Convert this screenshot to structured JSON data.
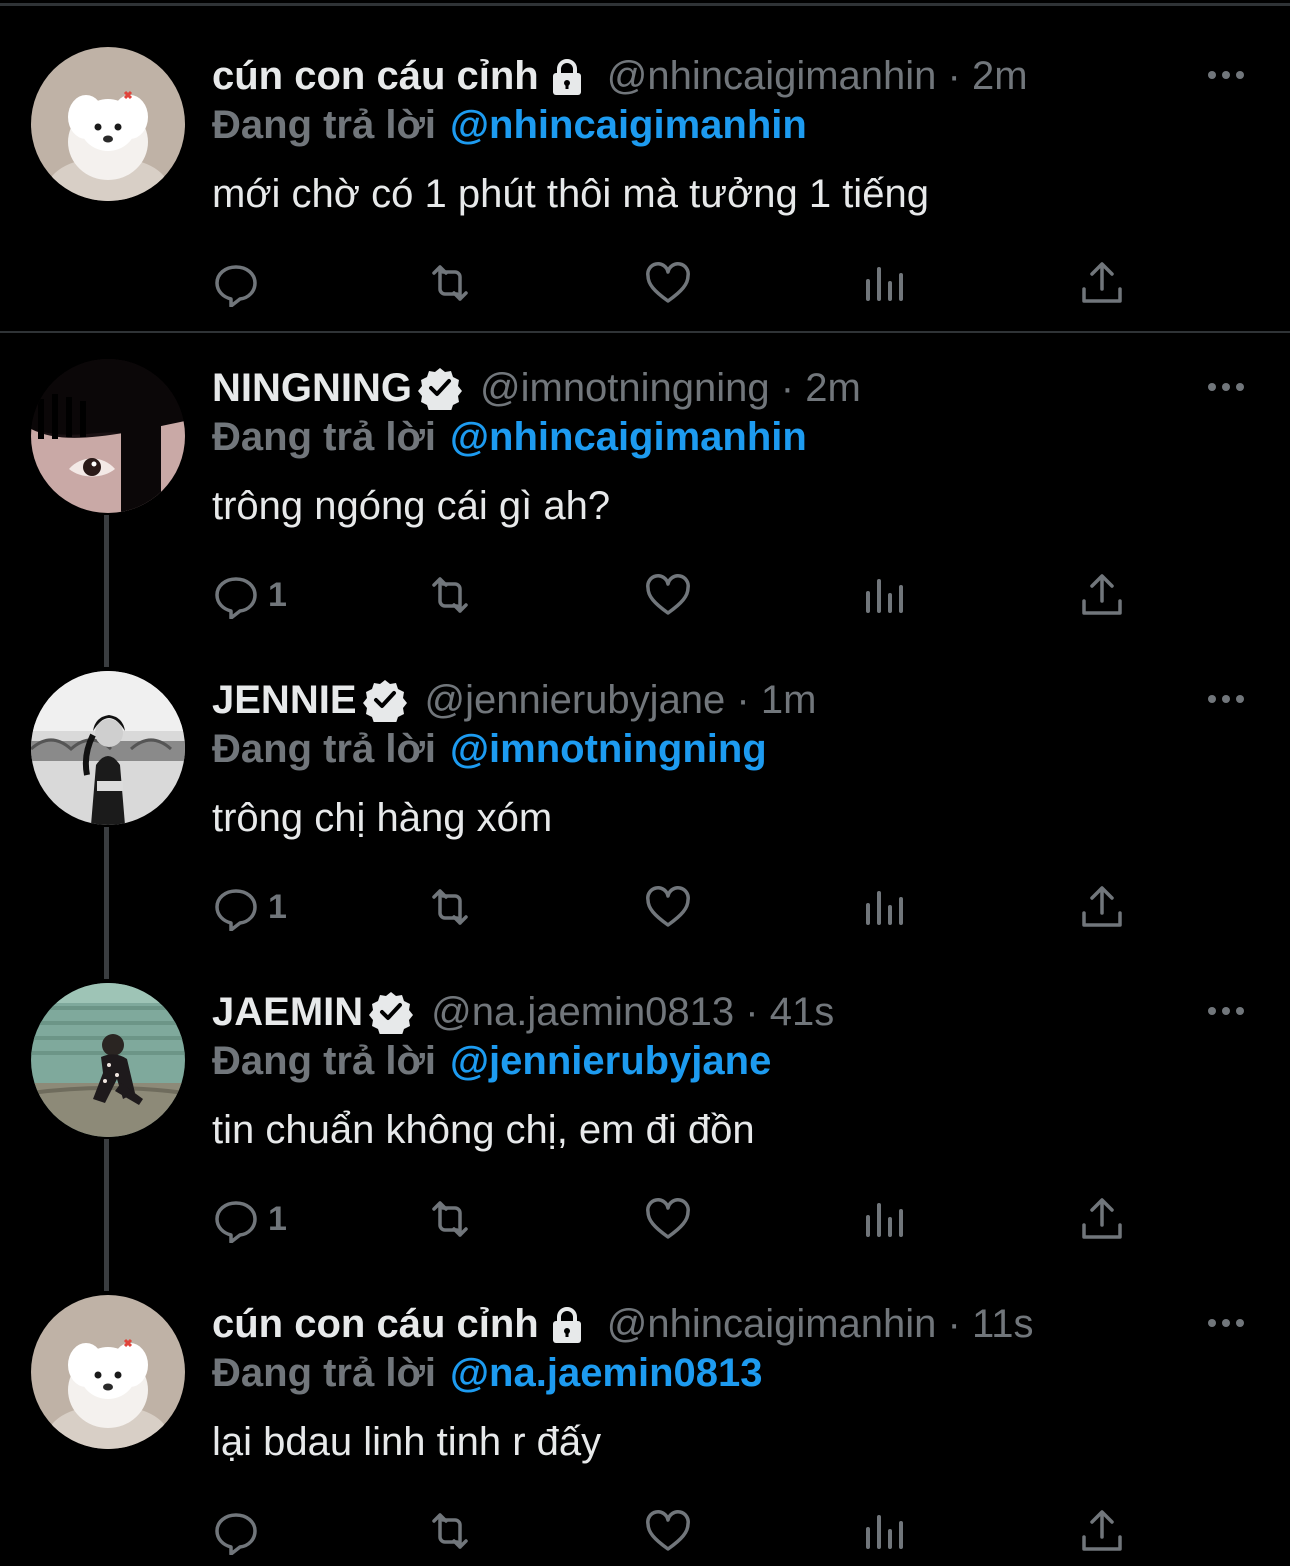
{
  "reply_prefix": "Đang trả lời",
  "colors": {
    "background": "#000000",
    "text": "#e7e9ea",
    "muted": "#71767b",
    "accent": "#1d9bf0",
    "divider": "#2f3336"
  },
  "tweets": [
    {
      "name": "cún con cáu cỉnh",
      "badge": "lock-icon",
      "handle_time": "@nhincaigimanhin · 2m",
      "reply_to": "@nhincaigimanhin",
      "text": "mới chờ có 1 phút thôi mà tưởng 1 tiếng",
      "reply_count": ""
    },
    {
      "name": "NINGNING",
      "badge": "verified-icon",
      "handle_time": "@imnotningning · 2m",
      "reply_to": "@nhincaigimanhin",
      "text": "trông ngóng cái gì ah?",
      "reply_count": "1"
    },
    {
      "name": "JENNIE",
      "badge": "verified-icon",
      "handle_time": "@jennierubyjane · 1m",
      "reply_to": "@imnotningning",
      "text": "trông chị hàng xóm",
      "reply_count": "1"
    },
    {
      "name": "JAEMIN",
      "badge": "verified-icon",
      "handle_time": "@na.jaemin0813 · 41s",
      "reply_to": "@jennierubyjane",
      "text": "tin chuẩn không chị, em đi đồn",
      "reply_count": "1"
    },
    {
      "name": "cún con cáu cỉnh",
      "badge": "lock-icon",
      "handle_time": "@nhincaigimanhin · 11s",
      "reply_to": "@na.jaemin0813",
      "text": "lại bdau linh tinh r đấy",
      "reply_count": ""
    }
  ]
}
